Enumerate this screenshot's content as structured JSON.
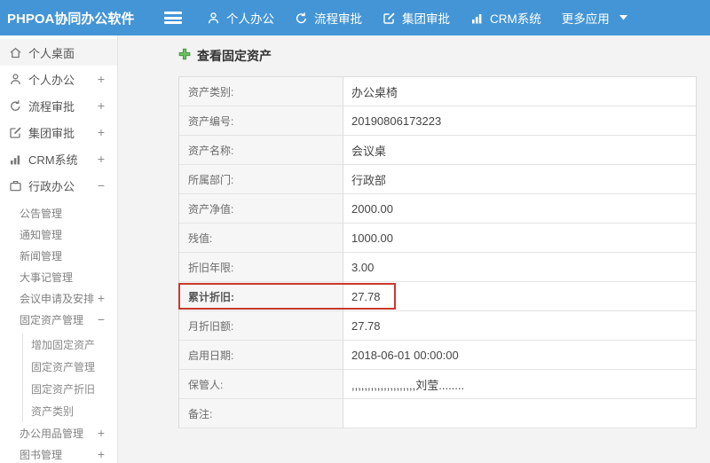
{
  "topbar": {
    "logo": "PHPOA协同办公软件",
    "nav": [
      {
        "label": "个人办公",
        "icon": "user-icon"
      },
      {
        "label": "流程审批",
        "icon": "workflow-icon"
      },
      {
        "label": "集团审批",
        "icon": "edit-icon"
      },
      {
        "label": "CRM系统",
        "icon": "bar-chart-icon"
      },
      {
        "label": "更多应用",
        "icon": "caret-down-icon"
      }
    ]
  },
  "sidebar": {
    "items": [
      {
        "label": "个人桌面",
        "toggle": "",
        "icon": "home-icon"
      },
      {
        "label": "个人办公",
        "toggle": "+",
        "icon": "user-icon"
      },
      {
        "label": "流程审批",
        "toggle": "+",
        "icon": "workflow-icon"
      },
      {
        "label": "集团审批",
        "toggle": "+",
        "icon": "edit-icon"
      },
      {
        "label": "CRM系统",
        "toggle": "+",
        "icon": "bar-chart-icon"
      },
      {
        "label": "行政办公",
        "toggle": "−",
        "icon": "briefcase-icon"
      },
      {
        "label": "公告管理",
        "toggle": ""
      },
      {
        "label": "通知管理",
        "toggle": ""
      },
      {
        "label": "新闻管理",
        "toggle": ""
      },
      {
        "label": "大事记管理",
        "toggle": ""
      },
      {
        "label": "会议申请及安排",
        "toggle": "+"
      },
      {
        "label": "固定资产管理",
        "toggle": "−"
      },
      {
        "label": "增加固定资产",
        "toggle": ""
      },
      {
        "label": "固定资产管理",
        "toggle": ""
      },
      {
        "label": "固定资产折旧",
        "toggle": ""
      },
      {
        "label": "资产类别",
        "toggle": ""
      },
      {
        "label": "办公用品管理",
        "toggle": "+"
      },
      {
        "label": "图书管理",
        "toggle": "+"
      }
    ]
  },
  "main": {
    "title": "查看固定资产",
    "table": {
      "rows": [
        {
          "label": "资产类别:",
          "value": "办公桌椅"
        },
        {
          "label": "资产编号:",
          "value": "20190806173223"
        },
        {
          "label": "资产名称:",
          "value": "会议桌"
        },
        {
          "label": "所属部门:",
          "value": "行政部"
        },
        {
          "label": "资产净值:",
          "value": "2000.00"
        },
        {
          "label": "残值:",
          "value": "1000.00"
        },
        {
          "label": "折旧年限:",
          "value": "3.00"
        },
        {
          "label": "累计折旧:",
          "value": "27.78",
          "highlighted": true
        },
        {
          "label": "月折旧额:",
          "value": "27.78"
        },
        {
          "label": "启用日期:",
          "value": "2018-06-01 00:00:00"
        },
        {
          "label": "保管人:",
          "value": ",,,,,,,,,,,,,,,,,,,,刘莹........"
        },
        {
          "label": "备注:",
          "value": ""
        }
      ]
    }
  },
  "colors": {
    "topbar_blue": "#4495d6",
    "accent_green": "#62b85c",
    "annotation_red": "#c8392e"
  }
}
